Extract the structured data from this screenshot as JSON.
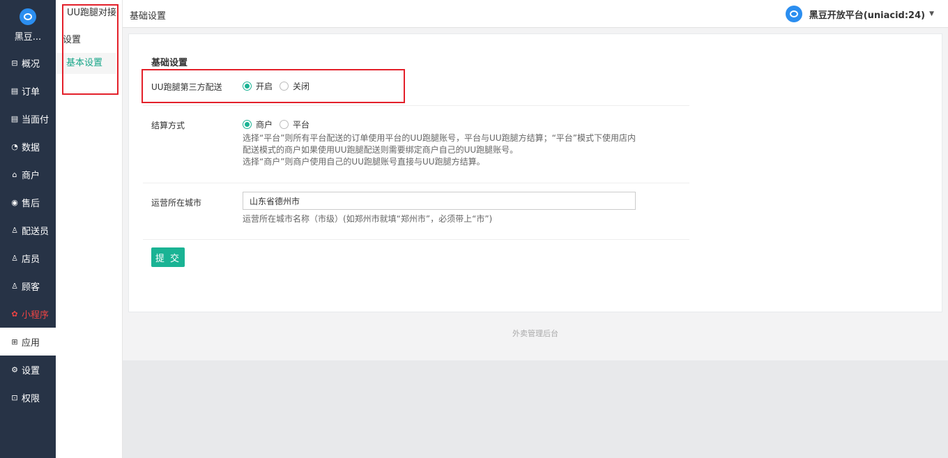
{
  "brand": {
    "name": "黑豆..."
  },
  "nav": [
    {
      "icon": "dashboard-icon",
      "glyph": "⊟",
      "label": "概况"
    },
    {
      "icon": "order-icon",
      "glyph": "▤",
      "label": "订单"
    },
    {
      "icon": "pay-icon",
      "glyph": "▤",
      "label": "当面付"
    },
    {
      "icon": "data-icon",
      "glyph": "◔",
      "label": "数据"
    },
    {
      "icon": "shop-icon",
      "glyph": "⌂",
      "label": "商户"
    },
    {
      "icon": "aftersale-icon",
      "glyph": "◉",
      "label": "售后"
    },
    {
      "icon": "courier-icon",
      "glyph": "♙",
      "label": "配送员"
    },
    {
      "icon": "clerk-icon",
      "glyph": "♙",
      "label": "店员"
    },
    {
      "icon": "customer-icon",
      "glyph": "♙",
      "label": "顾客"
    },
    {
      "icon": "miniprogram-icon",
      "glyph": "✿",
      "label": "小程序"
    },
    {
      "icon": "apps-icon",
      "glyph": "⊞",
      "label": "应用"
    },
    {
      "icon": "settings-icon",
      "glyph": "⚙",
      "label": "设置"
    },
    {
      "icon": "lock-icon",
      "glyph": "⊡",
      "label": "权限"
    }
  ],
  "subnav": {
    "title": "UU跑腿对接",
    "group": "设置",
    "link": "基本设置"
  },
  "header": {
    "breadcrumb": "基础设置",
    "user": "黑豆开放平台(uniacid:24)"
  },
  "form": {
    "title": "基础设置",
    "delivery": {
      "label": "UU跑腿第三方配送",
      "options": [
        "开启",
        "关闭"
      ],
      "selected": "开启"
    },
    "settlement": {
      "label": "结算方式",
      "options": [
        "商户",
        "平台"
      ],
      "selected": "商户",
      "help": [
        "选择“平台”则所有平台配送的订单使用平台的UU跑腿账号，平台与UU跑腿方结算；“平台”模式下使用店内",
        "配送模式的商户如果使用UU跑腿配送则需要绑定商户自己的UU跑腿账号。",
        "选择“商户”则商户使用自己的UU跑腿账号直接与UU跑腿方结算。"
      ]
    },
    "city": {
      "label": "运营所在城市",
      "value": "山东省德州市",
      "help": "运营所在城市名称（市级）(如郑州市就填“郑州市”，必须带上“市”)"
    },
    "submit": "提 交"
  },
  "footer": "外卖管理后台",
  "colors": {
    "sidebar": "#273346",
    "accent": "#1ab394",
    "highlight": "#e3202a"
  }
}
